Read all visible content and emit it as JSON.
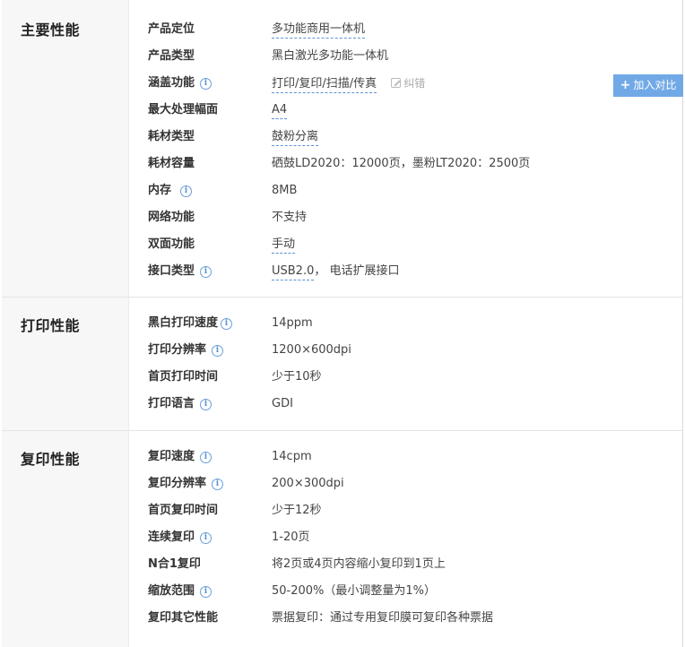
{
  "sections": [
    {
      "title": "主要性能",
      "rows": [
        {
          "label": "产品定位",
          "value": "多功能商用一体机"
        },
        {
          "label": "产品类型",
          "value": "黑白激光多功能一体机"
        },
        {
          "label": "涵盖功能",
          "value": "打印/复印/扫描/传真",
          "correct": "纠错"
        },
        {
          "label": "最大处理幅面",
          "value": "A4"
        },
        {
          "label": "耗材类型",
          "value": "鼓粉分离"
        },
        {
          "label": "耗材容量",
          "value": "硒鼓LD2020：12000页，墨粉LT2020：2500页"
        },
        {
          "label": "内存",
          "value": "8MB"
        },
        {
          "label": "网络功能",
          "value": "不支持"
        },
        {
          "label": "双面功能",
          "value": "手动"
        },
        {
          "label": "接口类型",
          "value_link": "USB2.0",
          "value_rest": "， 电话扩展接口"
        }
      ]
    },
    {
      "title": "打印性能",
      "rows": [
        {
          "label": "黑白打印速度",
          "value": "14ppm"
        },
        {
          "label": "打印分辨率",
          "value": "1200×600dpi"
        },
        {
          "label": "首页打印时间",
          "value": "少于10秒"
        },
        {
          "label": "打印语言",
          "value": "GDI"
        }
      ]
    },
    {
      "title": "复印性能",
      "rows": [
        {
          "label": "复印速度",
          "value": "14cpm"
        },
        {
          "label": "复印分辨率",
          "value": "200×300dpi"
        },
        {
          "label": "首页复印时间",
          "value": "少于12秒"
        },
        {
          "label": "连续复印",
          "value": "1-20页"
        },
        {
          "label": "N合1复印",
          "value": "将2页或4页内容缩小复印到1页上"
        },
        {
          "label": "缩放范围",
          "value": "50-200%（最小调整量为1%）"
        },
        {
          "label": "复印其它性能",
          "value": "票据复印：通过专用复印膜可复印各种票据"
        }
      ]
    }
  ],
  "compare_button": {
    "label": "加入对比",
    "icon": "plus-icon"
  },
  "info_icon_glyph": "i",
  "colors": {
    "accent": "#5b93d1",
    "button": "#71a9e6",
    "category_bg": "#f7f7f7"
  }
}
